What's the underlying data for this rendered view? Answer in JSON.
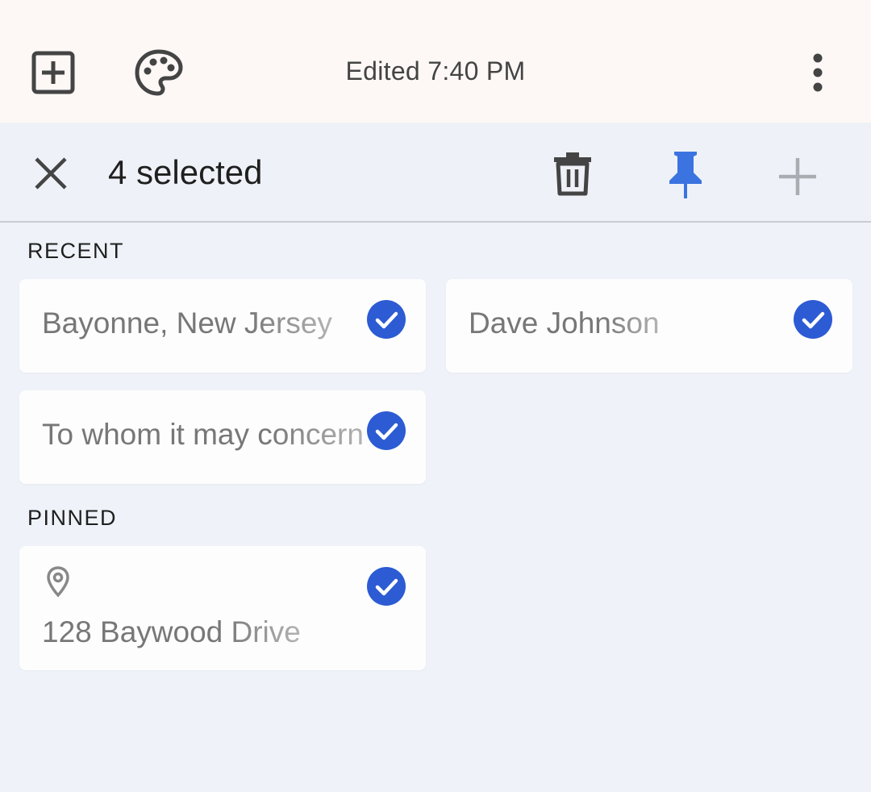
{
  "topbar": {
    "edited_label": "Edited 7:40 PM",
    "icons": [
      "add-box-icon",
      "palette-icon",
      "more-vert-icon"
    ]
  },
  "selection_bar": {
    "count_label": "4 selected",
    "icons": [
      "close-icon",
      "trash-icon",
      "pin-icon",
      "plus-icon"
    ],
    "pin_color": "#3b74e0"
  },
  "sections": {
    "recent": {
      "label": "RECENT",
      "notes": [
        {
          "title": "Bayonne, New Jersey",
          "selected": true
        },
        {
          "title": "Dave Johnson",
          "selected": true
        },
        {
          "title": "To whom it may concern",
          "selected": true
        }
      ]
    },
    "pinned": {
      "label": "PINNED",
      "notes": [
        {
          "title": "128 Baywood Drive",
          "icon": "location-pin-icon",
          "selected": true
        }
      ]
    }
  },
  "colors": {
    "check_blue": "#2c5bd3",
    "background": "#eff3f9",
    "topbar_bg": "#fdf8f6"
  }
}
